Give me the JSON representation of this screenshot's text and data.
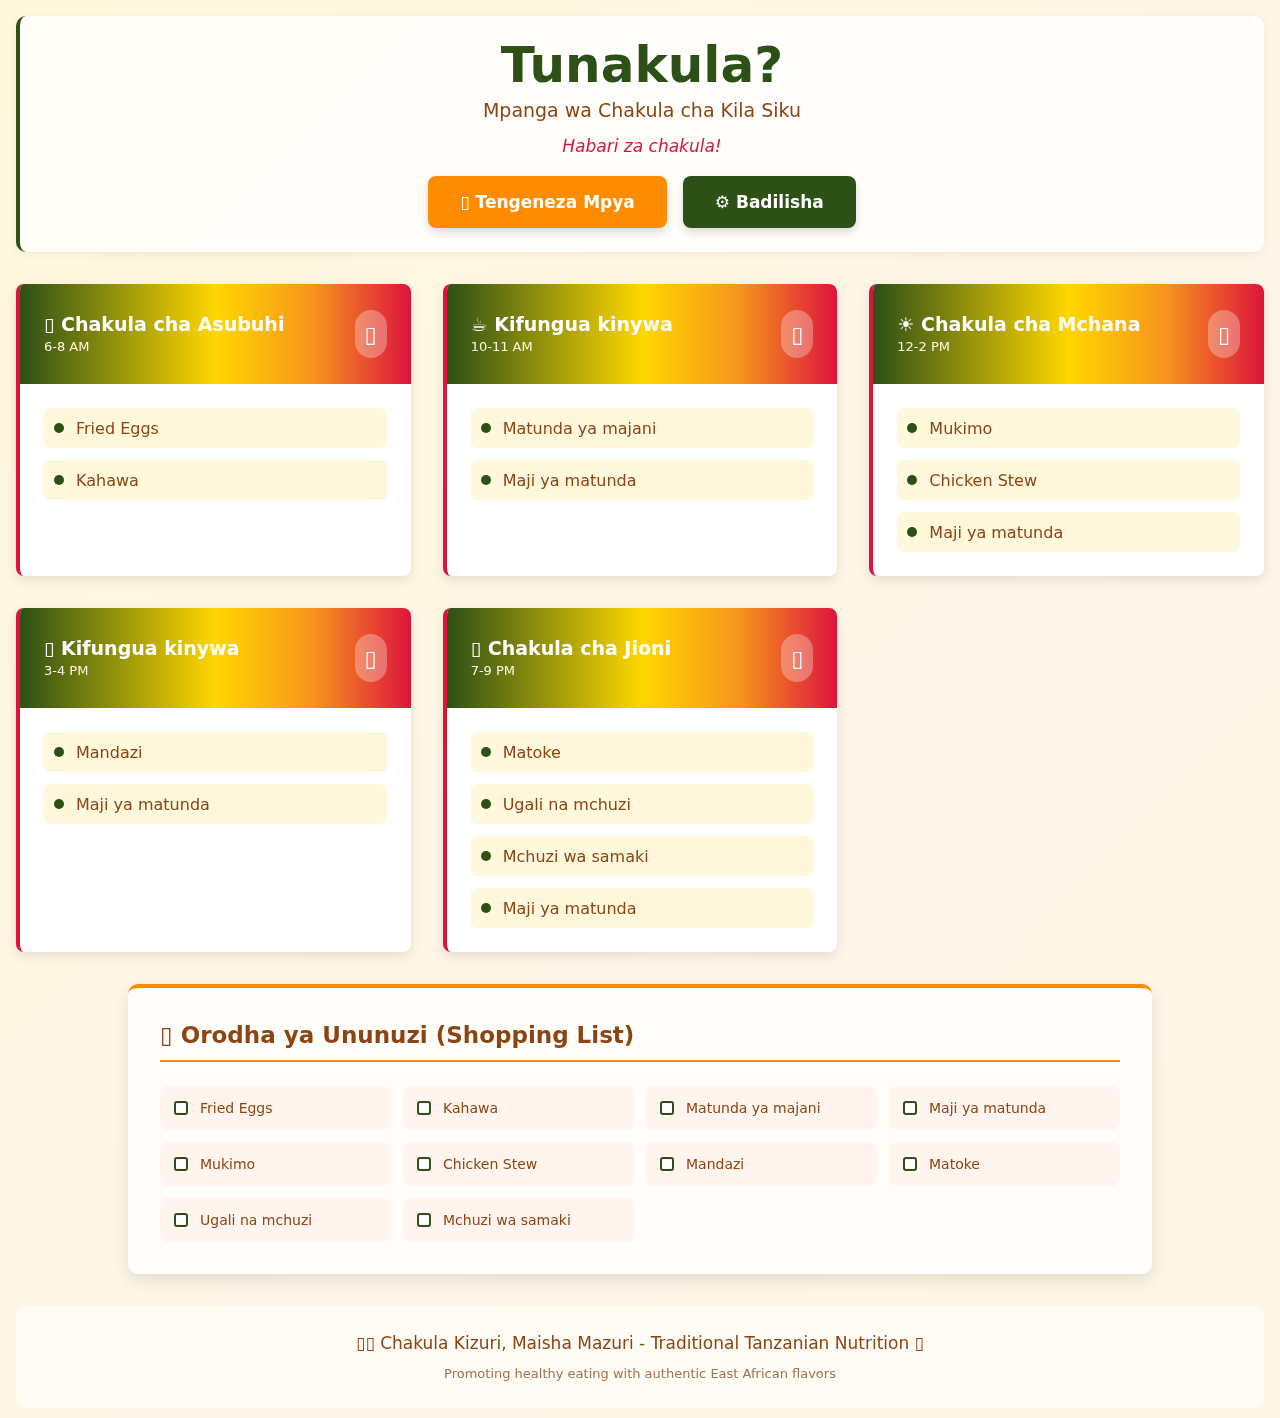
{
  "header": {
    "title": "Tunakula?",
    "subtitle": "Mpanga wa Chakula cha Kila Siku",
    "tagline": "Habari za chakula!",
    "buttons": [
      {
        "label": "▯ Tengeneza Mpya",
        "kind": "primary"
      },
      {
        "label": "⚙ Badilisha",
        "kind": "secondary"
      }
    ]
  },
  "meals": [
    {
      "title": "▯ Chakula cha Asubuhi",
      "time": "6-8 AM",
      "action": "▯",
      "items": [
        "Fried Eggs",
        "Kahawa"
      ]
    },
    {
      "title": "☕ Kifungua kinywa",
      "time": "10-11 AM",
      "action": "▯",
      "items": [
        "Matunda ya majani",
        "Maji ya matunda"
      ]
    },
    {
      "title": "☀ Chakula cha Mchana",
      "time": "12-2 PM",
      "action": "▯",
      "items": [
        "Mukimo",
        "Chicken Stew",
        "Maji ya matunda"
      ]
    },
    {
      "title": "▯ Kifungua kinywa",
      "time": "3-4 PM",
      "action": "▯",
      "items": [
        "Mandazi",
        "Maji ya matunda"
      ]
    },
    {
      "title": "▯ Chakula cha Jioni",
      "time": "7-9 PM",
      "action": "▯",
      "items": [
        "Matoke",
        "Ugali na mchuzi",
        "Mchuzi wa samaki",
        "Maji ya matunda"
      ]
    }
  ],
  "shopping": {
    "title": "▯ Orodha ya Ununuzi (Shopping List)",
    "items": [
      {
        "label": "Fried Eggs",
        "checked": false
      },
      {
        "label": "Kahawa",
        "checked": false
      },
      {
        "label": "Matunda ya majani",
        "checked": false
      },
      {
        "label": "Maji ya matunda",
        "checked": false
      },
      {
        "label": "Mukimo",
        "checked": false
      },
      {
        "label": "Chicken Stew",
        "checked": false
      },
      {
        "label": "Mandazi",
        "checked": false
      },
      {
        "label": "Matoke",
        "checked": false
      },
      {
        "label": "Ugali na mchuzi",
        "checked": false
      },
      {
        "label": "Mchuzi wa samaki",
        "checked": false
      }
    ]
  },
  "footer": {
    "text": "▯▯ Chakula Kizuri, Maisha Mazuri - Traditional Tanzanian Nutrition ▯",
    "subtext": "Promoting healthy eating with authentic East African flavors"
  }
}
